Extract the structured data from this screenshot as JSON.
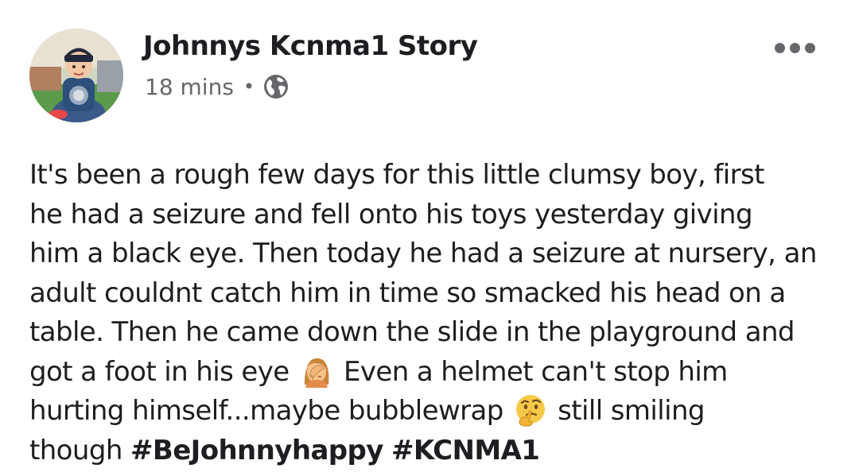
{
  "post": {
    "author": "Johnnys Kcnma1 Story",
    "time": "18 mins",
    "separator": "•",
    "privacy_icon": "globe-icon",
    "more_icon": "more-options-icon",
    "message_lines": {
      "l1": "It's been a rough few days for this little clumsy boy, first",
      "l2": "he had a seizure and fell onto his toys yesterday giving",
      "l3": "him a black eye. Then today he had a seizure at nursery, an",
      "l4": "adult couldnt catch him in time so smacked his head on a",
      "l5": "table. Then he came down the slide in the playground and",
      "l6a": "got a foot in his eye",
      "l6b": "Even a helmet can't stop him",
      "l7a": "hurting himself...maybe bubblewrap",
      "l7b": "still smiling",
      "l8a": "though"
    },
    "emojis": [
      "face-palm-emoji",
      "thinking-face-emoji"
    ],
    "hashtags": [
      "#BeJohnnyhappy",
      "#KCNMA1"
    ]
  },
  "colors": {
    "text": "#1c1e21",
    "secondary": "#65676b",
    "background": "#ffffff"
  }
}
